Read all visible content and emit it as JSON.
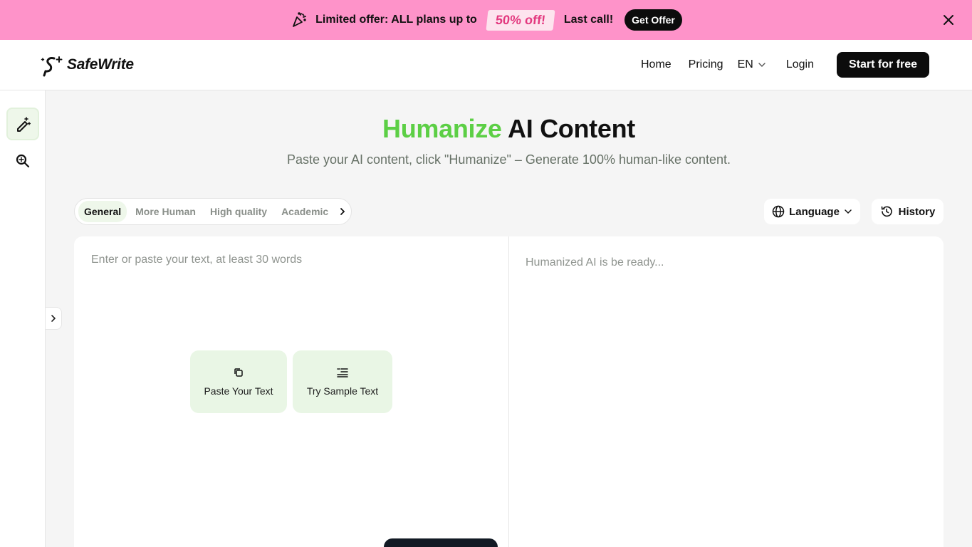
{
  "promo": {
    "text": "Limited offer: ALL plans up to",
    "badge": "50% off!",
    "last_call": "Last call!",
    "cta": "Get Offer",
    "bg_color": "#fe93c9",
    "close_icon": "close-icon"
  },
  "header": {
    "brand": "SafeWrite",
    "nav": {
      "home": "Home",
      "pricing": "Pricing",
      "language": "EN",
      "login": "Login",
      "start": "Start for free"
    }
  },
  "rail": {
    "items": [
      {
        "icon": "magic-pencil-icon",
        "active": true
      },
      {
        "icon": "sparkle-search-icon",
        "active": false
      }
    ]
  },
  "hero": {
    "title_accent": "Humanize",
    "title_rest": " AI Content",
    "subtitle": "Paste your AI content, click \"Humanize\" – Generate 100% human-like content.",
    "accent_color": "#5ccf45"
  },
  "modes": {
    "tabs": [
      "General",
      "More Human",
      "High quality",
      "Academic"
    ],
    "active": "General"
  },
  "toolbar": {
    "language": "Language",
    "history": "History"
  },
  "editor": {
    "input_placeholder": "Enter or paste your text, at least 30 words",
    "output_placeholder": "Humanized AI is be ready...",
    "paste_label": "Paste Your Text",
    "sample_label": "Try Sample Text"
  }
}
